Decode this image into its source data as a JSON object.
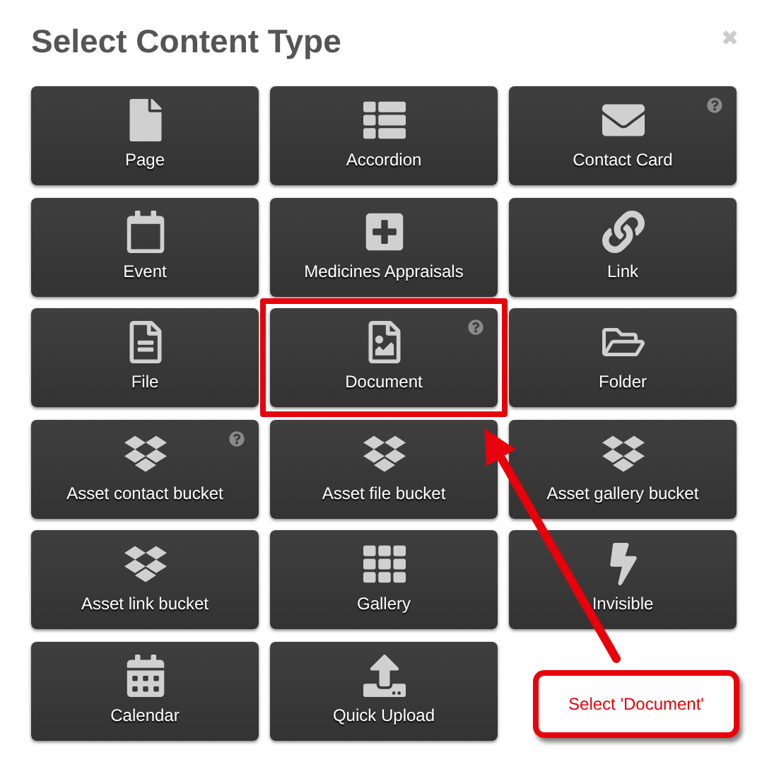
{
  "dialog": {
    "title": "Select Content Type",
    "close": "✖"
  },
  "items": [
    {
      "label": "Page",
      "help": false,
      "highlighted": false
    },
    {
      "label": "Accordion",
      "help": false,
      "highlighted": false
    },
    {
      "label": "Contact Card",
      "help": true,
      "highlighted": false
    },
    {
      "label": "Event",
      "help": false,
      "highlighted": false
    },
    {
      "label": "Medicines Appraisals",
      "help": false,
      "highlighted": false
    },
    {
      "label": "Link",
      "help": false,
      "highlighted": false
    },
    {
      "label": "File",
      "help": false,
      "highlighted": false
    },
    {
      "label": "Document",
      "help": true,
      "highlighted": true
    },
    {
      "label": "Folder",
      "help": false,
      "highlighted": false
    },
    {
      "label": "Asset contact bucket",
      "help": true,
      "highlighted": false
    },
    {
      "label": "Asset file bucket",
      "help": false,
      "highlighted": false
    },
    {
      "label": "Asset gallery bucket",
      "help": false,
      "highlighted": false
    },
    {
      "label": "Asset link bucket",
      "help": false,
      "highlighted": false
    },
    {
      "label": "Gallery",
      "help": false,
      "highlighted": false
    },
    {
      "label": "Invisible",
      "help": false,
      "highlighted": false
    },
    {
      "label": "Calendar",
      "help": false,
      "highlighted": false
    },
    {
      "label": "Quick Upload",
      "help": false,
      "highlighted": false
    }
  ],
  "callout": {
    "text": "Select 'Document'"
  }
}
